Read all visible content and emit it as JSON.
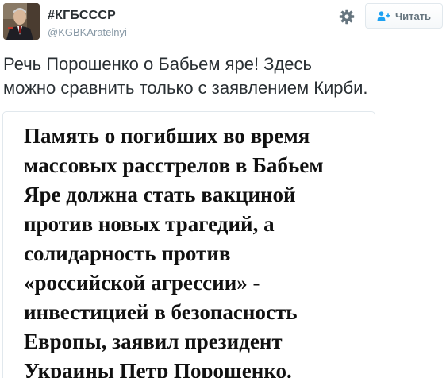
{
  "author": {
    "name": "#КГБСССР",
    "handle": "@KGBKAratelnyi",
    "avatar_icon": "portrait-avatar"
  },
  "header": {
    "settings_icon": "gear-icon",
    "follow_label": "Читать",
    "follow_icon": "add-user-icon"
  },
  "tweet": {
    "lines": [
      "Речь Порошенко о Бабьем яре! Здесь",
      "можно сравнить только с заявлением Кирби."
    ]
  },
  "media": {
    "lines": [
      "Память о погибших во время",
      "массовых расстрелов в Бабьем",
      "Яре должна стать вакциной",
      "против новых трагедий, а",
      "солидарность против",
      "«российской агрессии» -",
      "инвестицией в безопасность",
      "Европы, заявил президент",
      "Украины Петр Порошенко."
    ]
  },
  "colors": {
    "text": "#292f33",
    "muted": "#8899a6",
    "border": "#e1e8ed",
    "button_text": "#66757f"
  }
}
